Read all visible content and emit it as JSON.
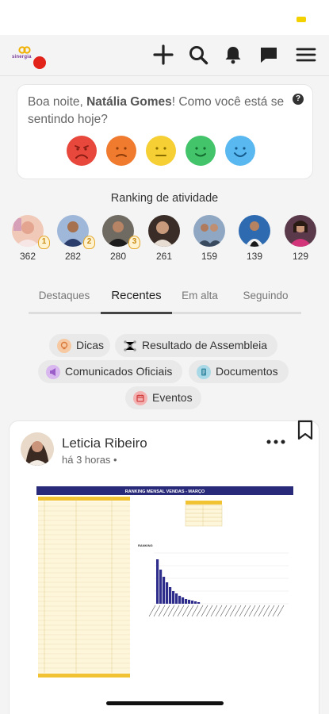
{
  "greeting": {
    "prefix": "Boa noite, ",
    "name": "Natália Gomes",
    "suffix": "! Como você está se sentindo hoje?"
  },
  "logo_text": "sinergia",
  "colors": {
    "mood_very_sad": "#e8483b",
    "mood_sad": "#f07b2e",
    "mood_neutral": "#f5cf33",
    "mood_happy": "#43c46a",
    "mood_very_happy": "#5ab8f0",
    "notification_red": "#e2231a"
  },
  "ranking": {
    "title": "Ranking de atividade",
    "users": [
      {
        "points": "362",
        "medal": "1"
      },
      {
        "points": "282",
        "medal": "2"
      },
      {
        "points": "280",
        "medal": "3"
      },
      {
        "points": "261"
      },
      {
        "points": "159"
      },
      {
        "points": "139"
      },
      {
        "points": "129"
      }
    ]
  },
  "tabs": [
    {
      "label": "Destaques"
    },
    {
      "label": "Recentes"
    },
    {
      "label": "Em alta"
    },
    {
      "label": "Seguindo"
    }
  ],
  "categories": [
    {
      "label": "Dicas",
      "icon": "lightbulb-icon"
    },
    {
      "label": "Resultado de Assembleia",
      "icon": "network-icon"
    },
    {
      "label": "Comunicados Oficiais",
      "icon": "megaphone-icon"
    },
    {
      "label": "Documentos",
      "icon": "document-icon"
    },
    {
      "label": "Eventos",
      "icon": "calendar-icon"
    }
  ],
  "post": {
    "author": "Leticia Ribeiro",
    "time": "há 3 horas •",
    "image_title": "RANKING MENSAL VENDAS - MARÇO",
    "image_chart_label": "RANKING"
  }
}
